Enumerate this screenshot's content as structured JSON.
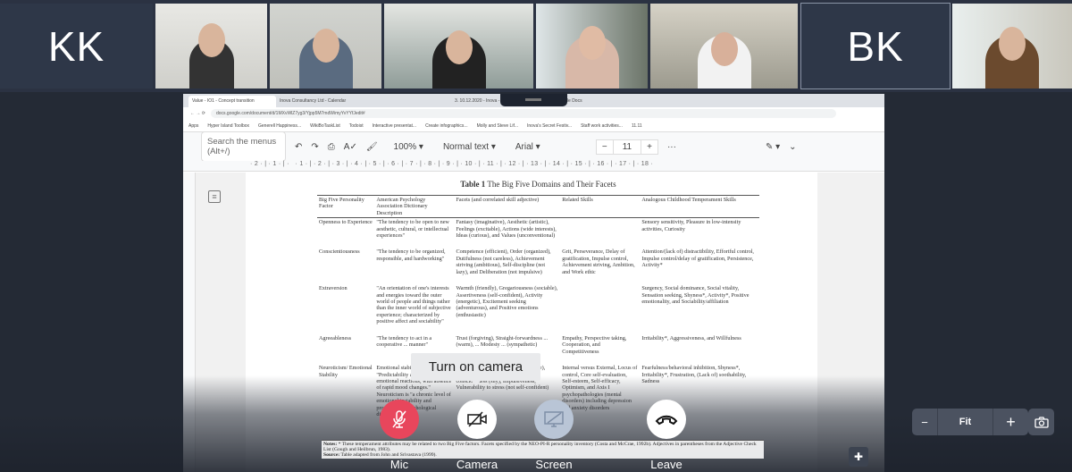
{
  "participants": [
    {
      "initials": "KK"
    },
    {
      "video": true
    },
    {
      "video": true
    },
    {
      "video": true
    },
    {
      "video": true
    },
    {
      "video": true
    },
    {
      "initials": "BK",
      "selected": true
    },
    {
      "video": true
    }
  ],
  "browser": {
    "tabs": [
      "Value - IO1 - Concept transition",
      "Inova Consultancy Ltd - Calendar",
      "3. 10.12.2020 - Inova - Google Drive",
      "Agenda - Google Docs"
    ],
    "url": "docs.google.com/document/d/1MXvWlZ7yg3/Yjpp5M7mdWimyYvYYfJedit#",
    "bookmarks": [
      "Apps",
      "Hyper Island Toolbox",
      "Generell Happiness...",
      "WikiBoTaskList",
      "Todoist",
      "Interactive presentat...",
      "Create infographics...",
      "Molly and Steve Lif...",
      "Inova's Secret Festiv...",
      "Staff work activities...",
      "11.11"
    ]
  },
  "docs": {
    "search_placeholder": "Search the menus (Alt+/)",
    "zoom": "100%",
    "style": "Normal text",
    "font": "Arial",
    "font_size": "11",
    "ruler": "· 2 · | · 1 · | ·   · 1 · | · 2 · | · 3 · | · 4 · | · 5 · | · 6 · | · 7 · | · 8 · | · 9 · | · 10 · | · 11 · | · 12 · | · 13 · | · 14 · | · 15 · | · 16 · | · 17 · | · 18 ·"
  },
  "table": {
    "label": "Table 1",
    "title": "The Big Five Domains and Their Facets",
    "headers": [
      "Big Five Personality Factor",
      "American Psychology Association Dictionary Description",
      "Facets (and correlated skill adjective)",
      "Related Skills",
      "Analogous Childhood Temperament Skills"
    ],
    "rows": [
      [
        "Openness to Experience",
        "\"The tendency to be open to new aesthetic, cultural, or intellectual experiences\"",
        "Fantasy (imaginative), Aesthetic (artistic), Feelings (excitable), Actions (wide interests), Ideas (curious), and Values (unconventional)",
        "",
        "Sensory sensitivity, Pleasure in low-intensity activities, Curiosity"
      ],
      [
        "Conscientiousness",
        "\"The tendency to be organized, responsible, and hardworking\"",
        "Competence (efficient), Order (organized), Dutifulness (not careless), Achievement striving (ambitious), Self-discipline (not lazy), and Deliberation (not impulsive)",
        "Grit, Perseverance, Delay of gratification, Impulse control, Achievement striving, Ambition, and Work ethic",
        "Attention/(lack of) distractibility, Effortful control, Impulse control/delay of gratification, Persistence, Activity*"
      ],
      [
        "Extraversion",
        "\"An orientation of one's interests and energies toward the outer world of people and things rather than the inner world of subjective experience; characterized by positive affect and sociability\"",
        "Warmth (friendly), Gregariousness (sociable), Assertiveness (self-confident), Activity (energetic), Excitement seeking (adventurous), and Positive emotions (enthusiastic)",
        "",
        "Surgency, Social dominance, Social vitality, Sensation seeking, Shyness*, Activity*, Positive emotionality, and Sociability/affiliation"
      ],
      [
        "Agreeableness",
        "\"The tendency to act in a cooperative ... manner\"",
        "Trust (forgiving), Straight-forwardness ... (warm), ... Modesty ... (sympathetic)",
        "Empathy, Perspective taking, Cooperation, and Competitiveness",
        "Irritability*, Aggressiveness, and Willfulness"
      ],
      [
        "Neuroticism/ Emotional Stability",
        "Emotional stability is \"Predictability and consistency in emotional reactions, with absence of rapid mood changes.\" Neuroticism is \"a chronic level of emotional instability and proneness to psychological distress\"",
        "Anxiety (worrying), Hostility (irritable), Depression (not contented), Self-consciousness (shy), Impulsiveness, Vulnerability to stress (not self-confident)",
        "Internal versus External, Locus of control, Core self-evaluation, Self-esteem, Self-efficacy, Optimism, and Axis I psychopathologies (mental disorders) including depression and anxiety disorders",
        "Fearfulness/behavioral inhibition, Shyness*, Irritability*, Frustration, (Lack of) soothability, Sadness"
      ]
    ],
    "notes_label": "Notes:",
    "notes": "* These temperament attributes may be related to two Big Five factors. Facets specified by the NEO-PI-R personality inventory (Costa and McCrae, 1992b). Adjectives in parentheses from the Adjective Check List (Gough and Heilbrun, 1983).",
    "source_label": "Source:",
    "source": "Table adapted from John and Srivastava (1999)."
  },
  "call_controls": {
    "tooltip": "Turn on camera",
    "mic": "Mic",
    "camera": "Camera",
    "screen": "Screen",
    "leave": "Leave",
    "mic_color": "#e8465c"
  },
  "view_controls": {
    "zoom_out": "−",
    "fit": "Fit",
    "zoom_in": "+"
  }
}
